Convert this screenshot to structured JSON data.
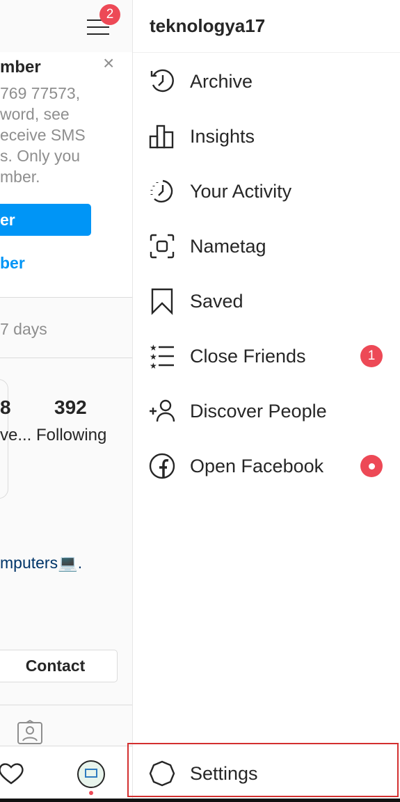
{
  "left": {
    "menu_badge": "2",
    "card": {
      "title": "mber",
      "lines": [
        "769 77573,",
        "word, see",
        "eceive SMS",
        "s. Only you",
        "mber."
      ],
      "primary_button": "er",
      "link": "ber"
    },
    "notice": "7 days",
    "stats": {
      "followers_count": "8",
      "followers_label": "ve...",
      "following_count": "392",
      "following_label": "Following"
    },
    "bio": "mputers💻.",
    "contact_button": "Contact"
  },
  "drawer": {
    "username": "teknologya17",
    "items": [
      {
        "label": "Archive",
        "icon": "archive-clock-icon"
      },
      {
        "label": "Insights",
        "icon": "bar-chart-icon"
      },
      {
        "label": "Your Activity",
        "icon": "activity-clock-icon"
      },
      {
        "label": "Nametag",
        "icon": "nametag-icon"
      },
      {
        "label": "Saved",
        "icon": "bookmark-icon"
      },
      {
        "label": "Close Friends",
        "icon": "close-friends-icon",
        "badge": "1"
      },
      {
        "label": "Discover People",
        "icon": "add-person-icon"
      },
      {
        "label": "Open Facebook",
        "icon": "facebook-icon",
        "badge_dot": true
      }
    ],
    "settings": "Settings"
  },
  "colors": {
    "accent": "#0095f6",
    "badge": "#ed4956",
    "highlight_box": "#d32f2f"
  }
}
